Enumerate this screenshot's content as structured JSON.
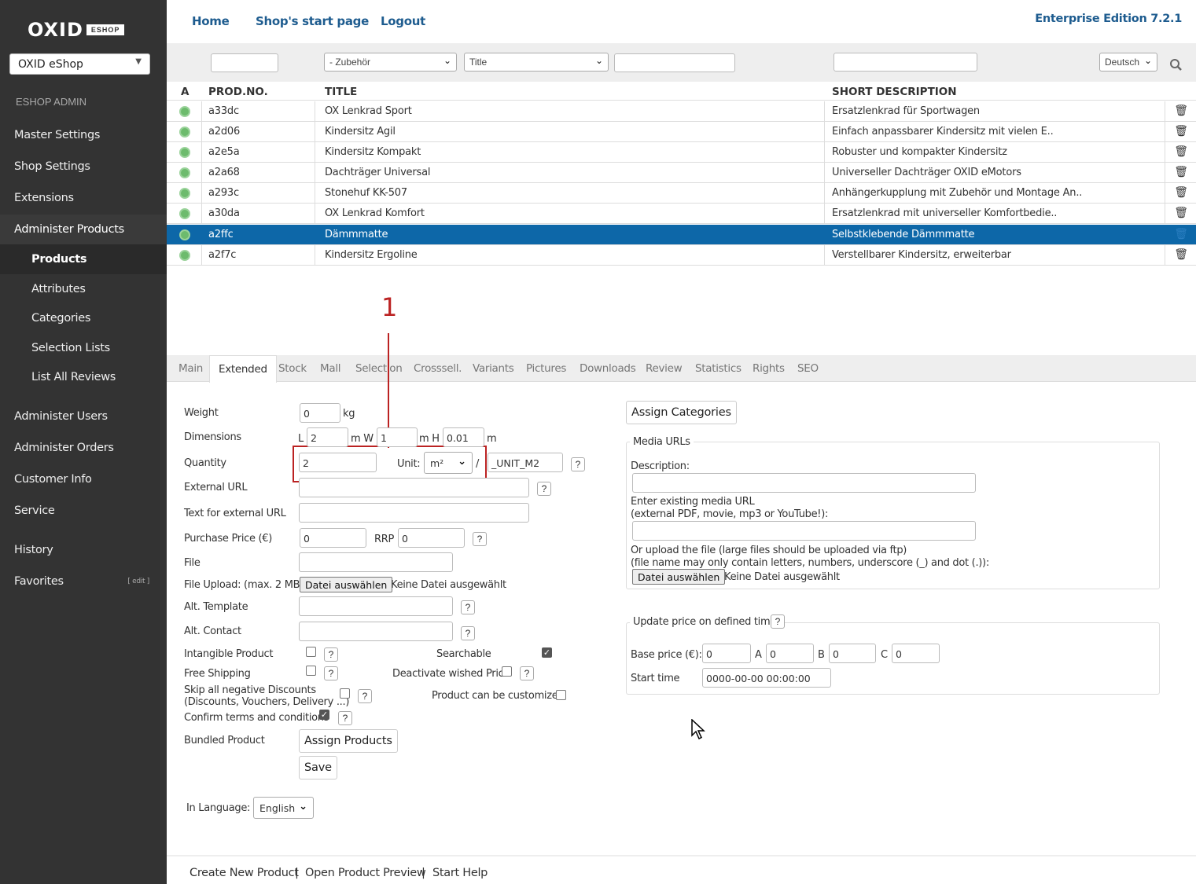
{
  "sidebar": {
    "logo": "OXID",
    "logo_badge": "ESHOP",
    "shop_select": "OXID eShop",
    "heading": "ESHOP ADMIN",
    "items": [
      {
        "label": "Master Settings"
      },
      {
        "label": "Shop Settings"
      },
      {
        "label": "Extensions"
      },
      {
        "label": "Administer Products"
      },
      {
        "label": "Products"
      },
      {
        "label": "Attributes"
      },
      {
        "label": "Categories"
      },
      {
        "label": "Selection Lists"
      },
      {
        "label": "List All Reviews"
      },
      {
        "label": "Administer Users"
      },
      {
        "label": "Administer Orders"
      },
      {
        "label": "Customer Info"
      },
      {
        "label": "Service"
      },
      {
        "label": "History"
      },
      {
        "label": "Favorites"
      }
    ],
    "favorites_edit": "[ edit ]"
  },
  "topbar": {
    "links": [
      "Home",
      "Shop's start page",
      "Logout"
    ],
    "edition": "Enterprise Edition 7.2.1"
  },
  "filters": {
    "category": "- Zubehör",
    "field": "Title",
    "language": "Deutsch"
  },
  "table": {
    "headers": [
      "A",
      "PROD.NO.",
      "TITLE",
      "SHORT DESCRIPTION"
    ],
    "rows": [
      {
        "no": "a33dc",
        "title": "OX Lenkrad Sport",
        "desc": "Ersatzlenkrad für Sportwagen"
      },
      {
        "no": "a2d06",
        "title": "Kindersitz Agil",
        "desc": "Einfach anpassbarer Kindersitz mit vielen E.."
      },
      {
        "no": "a2e5a",
        "title": "Kindersitz Kompakt",
        "desc": "Robuster und kompakter Kindersitz"
      },
      {
        "no": "a2a68",
        "title": "Dachträger Universal",
        "desc": "Universeller Dachträger OXID eMotors"
      },
      {
        "no": "a293c",
        "title": "Stonehuf KK-507",
        "desc": "Anhängerkupplung mit Zubehör und Montage An.."
      },
      {
        "no": "a30da",
        "title": "OX Lenkrad Komfort",
        "desc": "Ersatzlenkrad mit universeller Komfortbedie.."
      },
      {
        "no": "a2ffc",
        "title": "Dämmmatte",
        "desc": "Selbstklebende Dämmmatte"
      },
      {
        "no": "a2f7c",
        "title": "Kindersitz Ergoline",
        "desc": "Verstellbarer Kindersitz, erweiterbar"
      }
    ]
  },
  "annotation": "1",
  "tabs": [
    "Main",
    "Extended",
    "Stock",
    "Mall",
    "Selection",
    "Crosssell.",
    "Variants",
    "Pictures",
    "Downloads",
    "Review",
    "Statistics",
    "Rights",
    "SEO"
  ],
  "form": {
    "weight_label": "Weight",
    "weight": "0",
    "weight_unit": "kg",
    "dimensions_label": "Dimensions",
    "dim_l": "L",
    "l_val": "2",
    "dim_m1": "m W",
    "w_val": "1",
    "dim_m2": "m H",
    "h_val": "0.01",
    "dim_m3": "m",
    "quantity_label": "Quantity",
    "quantity": "2",
    "unit_label": "Unit:",
    "unit": "m²",
    "slash": "/",
    "unit_custom": "_UNIT_M2",
    "ext_url_label": "External URL",
    "ext_url_text_label": "Text for external URL",
    "purchase_label": "Purchase Price (€)",
    "purchase": "0",
    "rrp_label": "RRP",
    "rrp": "0",
    "file_label": "File",
    "file_upload_label": "File Upload: (max. 2 MB)",
    "file_button": "Datei auswählen",
    "no_file": "Keine Datei ausgewählt",
    "alt_template_label": "Alt. Template",
    "alt_contact_label": "Alt. Contact",
    "intangible_label": "Intangible Product",
    "searchable_label": "Searchable",
    "free_shipping_label": "Free Shipping",
    "deactivate_label": "Deactivate wished Price",
    "skip_label_1": "Skip all negative Discounts",
    "skip_label_2": "(Discounts, Vouchers, Delivery ...)",
    "customized_label": "Product can be customized",
    "confirm_label": "Confirm terms and conditions",
    "bundled_label": "Bundled Product",
    "assign_products": "Assign Products",
    "save": "Save",
    "in_language_label": "In Language:",
    "in_language": "English"
  },
  "right": {
    "assign_categories": "Assign Categories",
    "media_legend": "Media URLs",
    "description_label": "Description:",
    "media_url_label_1": "Enter existing media URL",
    "media_url_label_2": "(external PDF, movie, mp3 or YouTube!):",
    "upload_label_1": "Or upload the file (large files should be uploaded via ftp)",
    "upload_label_2": "(file name may only contain letters, numbers, underscore (_) and dot (.)):",
    "file_button": "Datei auswählen",
    "no_file": "Keine Datei ausgewählt",
    "price_legend": "Update price on defined time",
    "base_price_label": "Base price (€):",
    "base_price": "0",
    "a_label": "A",
    "a": "0",
    "b_label": "B",
    "b": "0",
    "c_label": "C",
    "c": "0",
    "start_time_label": "Start time",
    "start_time": "0000-00-00 00:00:00"
  },
  "footer": {
    "links": [
      "Create New Product",
      "Open Product Preview",
      "Start Help"
    ],
    "sep": "|"
  }
}
